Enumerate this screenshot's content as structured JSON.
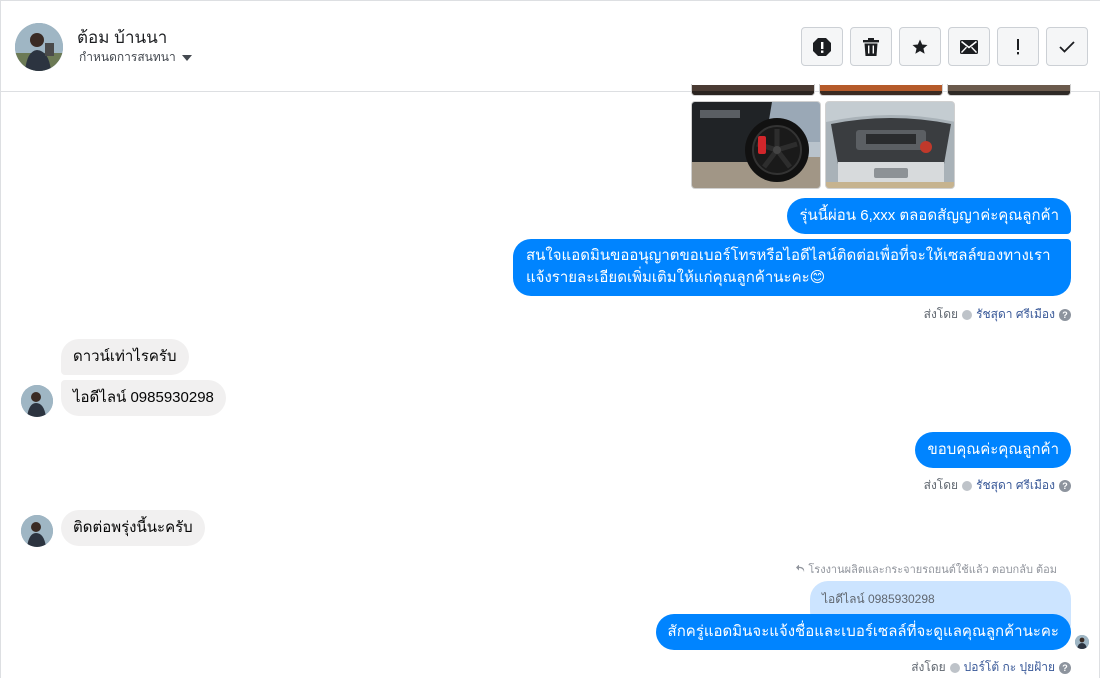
{
  "header": {
    "contact_name": "ต้อม บ้านนา",
    "conversation_settings": "กำหนดการสนทนา"
  },
  "toolbar": {
    "buttons": [
      {
        "icon": "report-icon"
      },
      {
        "icon": "trash-icon"
      },
      {
        "icon": "star-icon"
      },
      {
        "icon": "envelope-icon"
      },
      {
        "icon": "exclamation-icon",
        "label": "!"
      },
      {
        "icon": "checkmark-icon"
      }
    ]
  },
  "messages": {
    "out_1": "รุ่นนี้ผ่อน 6,xxx ตลอดสัญญาค่ะคุณลูกค้า",
    "out_2": "สนใจแอดมินขออนุญาตขอเบอร์โทรหรือไอดีไลน์ติดต่อเพื่อที่จะให้เซลล์ของทางเราแจ้งรายละเอียดเพิ่มเติมให้แก่คุณลูกค้านะคะ😊",
    "sent_by_1": {
      "prefix": "ส่งโดย",
      "agent": "รัชสุดา ศรีเมือง"
    },
    "in_1": "ดาวน์เท่าไรครับ",
    "in_2": "ไอดีไลน์ 0985930298",
    "out_3": "ขอบคุณค่ะคุณลูกค้า",
    "sent_by_2": {
      "prefix": "ส่งโดย",
      "agent": "รัชสุดา ศรีเมือง"
    },
    "in_3": "ติดต่อพรุ่งนี้นะครับ",
    "reply_note": "โรงงานผลิตและกระจายรถยนต์ใช้แล้ว ตอบกลับ ต้อม",
    "quoted_text": "ไอดีไลน์ 0985930298",
    "out_4": "สักครู่แอดมินจะแจ้งชื่อและเบอร์เซลล์ที่จะดูแลคุณลูกค้านะคะ",
    "sent_by_3": {
      "prefix": "ส่งโดย",
      "agent": "ปอร์โต้ กะ ปุยฝ้าย"
    },
    "help_mark": "?"
  },
  "colors": {
    "outgoing_bubble": "#0084ff",
    "incoming_bubble": "#f1f0f0",
    "quoted_bubble": "#cce4ff"
  }
}
